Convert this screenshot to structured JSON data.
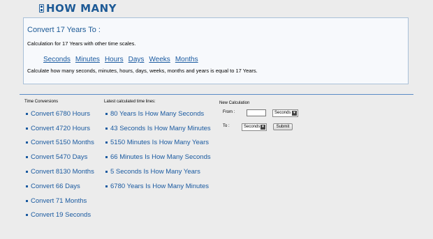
{
  "logo": {
    "text": "HOW MANY"
  },
  "intro": {
    "title": "Convert 17 Years To :",
    "subtitle": "Calculation for 17 Years with other time scales.",
    "units": [
      "Seconds",
      "Minutes",
      "Hours",
      "Days",
      "Weeks",
      "Months"
    ],
    "description": "Calculate how many seconds, minutes, hours, days, weeks, months and years is equal to 17 Years."
  },
  "time_conversions": {
    "title": "Time Conversions",
    "items": [
      "Convert 6780 Hours",
      "Convert 4720 Hours",
      "Convert 5150 Months",
      "Convert 5470 Days",
      "Convert 8130 Months",
      "Convert 66 Days",
      "Convert 71 Months",
      "Convert 19 Seconds"
    ]
  },
  "latest": {
    "title": "Latest calculated time lines:",
    "items": [
      "80 Years Is How Many Seconds",
      "43 Seconds Is How Many Minutes",
      "5150 Minutes Is How Many Years",
      "66 Minutes Is How Many Seconds",
      "5 Seconds Is How Many Years",
      "6780 Years Is How Many Minutes"
    ]
  },
  "new_calc": {
    "title": "New Calculation",
    "from_label": "From :",
    "to_label": "To :",
    "from_value": "",
    "from_unit": "Seconds",
    "to_unit": "Seconds",
    "submit": "Submit"
  },
  "colors": {
    "brand": "#1d5a96",
    "link": "#1a5aa0",
    "divider": "#5a8cc6",
    "background": "#ececec"
  }
}
